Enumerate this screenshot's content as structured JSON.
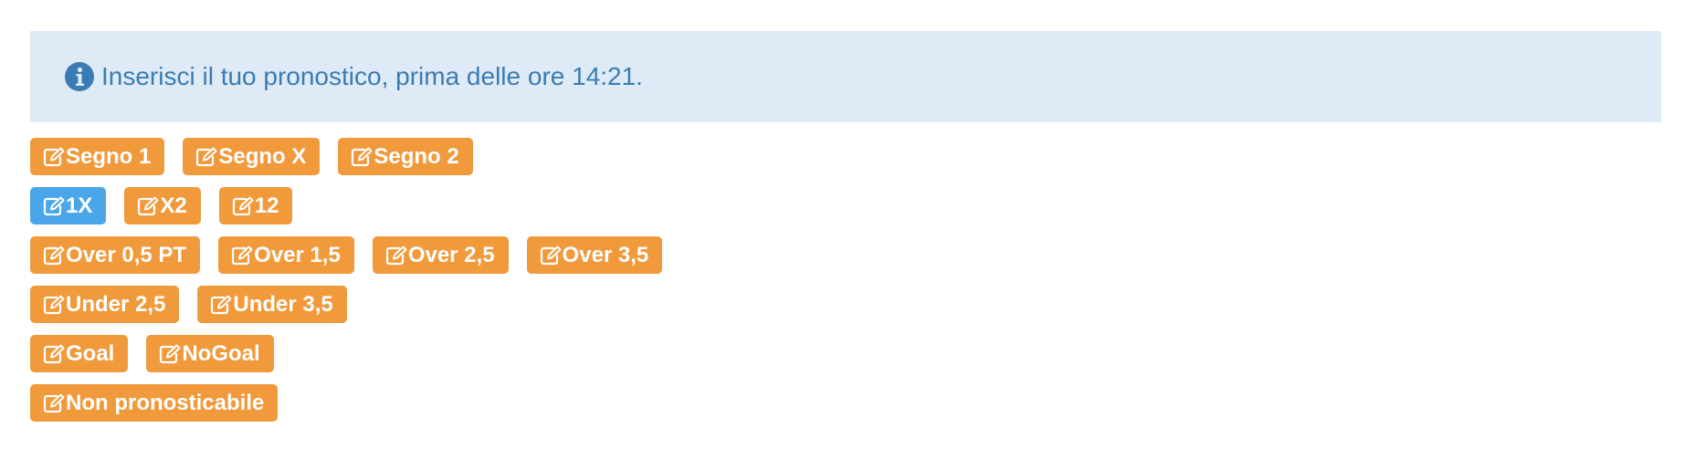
{
  "alert": {
    "icon": "info-circle-icon",
    "text": "Inserisci il tuo pronostico, prima delle ore 14:21."
  },
  "colors": {
    "alert_bg": "#deebf6",
    "alert_text": "#3a7bb4",
    "button_default": "#f09a3c",
    "button_selected": "#4aa6e8"
  },
  "rows": [
    {
      "buttons": [
        {
          "label": "Segno 1",
          "selected": false
        },
        {
          "label": "Segno X",
          "selected": false
        },
        {
          "label": "Segno 2",
          "selected": false
        }
      ]
    },
    {
      "buttons": [
        {
          "label": "1X",
          "selected": true
        },
        {
          "label": "X2",
          "selected": false
        },
        {
          "label": "12",
          "selected": false
        }
      ]
    },
    {
      "buttons": [
        {
          "label": "Over 0,5 PT",
          "selected": false
        },
        {
          "label": "Over 1,5",
          "selected": false
        },
        {
          "label": "Over 2,5",
          "selected": false
        },
        {
          "label": "Over 3,5",
          "selected": false
        }
      ]
    },
    {
      "buttons": [
        {
          "label": "Under 2,5",
          "selected": false
        },
        {
          "label": "Under 3,5",
          "selected": false
        }
      ]
    },
    {
      "buttons": [
        {
          "label": "Goal",
          "selected": false
        },
        {
          "label": "NoGoal",
          "selected": false
        }
      ]
    },
    {
      "buttons": [
        {
          "label": "Non pronosticabile",
          "selected": false
        }
      ]
    }
  ],
  "button_icon": "edit-icon"
}
